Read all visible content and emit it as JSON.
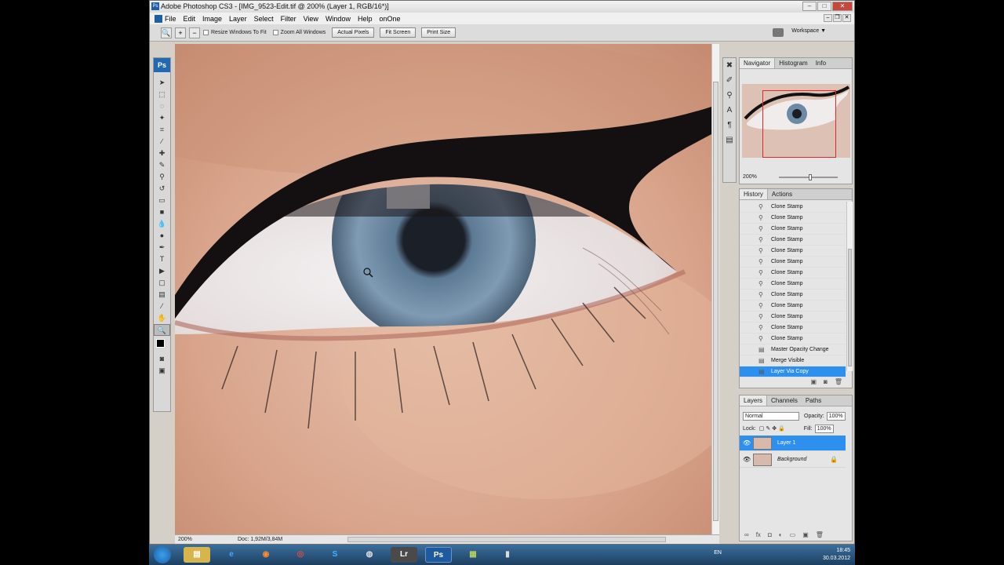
{
  "window": {
    "title": "Adobe Photoshop CS3 - [IMG_9523-Edit.tif @ 200% (Layer 1, RGB/16*)]",
    "app_badge": "Ps"
  },
  "menu": [
    "File",
    "Edit",
    "Image",
    "Layer",
    "Select",
    "Filter",
    "View",
    "Window",
    "Help",
    "onOne"
  ],
  "options_bar": {
    "resize_windows": "Resize Windows To Fit",
    "zoom_all": "Zoom All Windows",
    "actual_pixels": "Actual Pixels",
    "fit_screen": "Fit Screen",
    "print_size": "Print Size",
    "workspace": "Workspace ▼"
  },
  "status_bar": {
    "zoom": "200%",
    "doc": "Doc: 1,92M/3,84M"
  },
  "navigator": {
    "tabs": [
      "Navigator",
      "Histogram",
      "Info"
    ],
    "zoom": "200%"
  },
  "history": {
    "tabs": [
      "History",
      "Actions"
    ],
    "items": [
      "Clone Stamp",
      "Clone Stamp",
      "Clone Stamp",
      "Clone Stamp",
      "Clone Stamp",
      "Clone Stamp",
      "Clone Stamp",
      "Clone Stamp",
      "Clone Stamp",
      "Clone Stamp",
      "Clone Stamp",
      "Clone Stamp",
      "Clone Stamp",
      "Master Opacity Change",
      "Merge Visible",
      "Layer Via Copy"
    ]
  },
  "layers": {
    "tabs": [
      "Layers",
      "Channels",
      "Paths"
    ],
    "blend_mode": "Normal",
    "opacity_label": "Opacity:",
    "opacity": "100%",
    "lock_label": "Lock:",
    "fill_label": "Fill:",
    "fill": "100%",
    "items": [
      "Layer 1",
      "Background"
    ]
  },
  "taskbar": {
    "lang": "EN",
    "time": "18:45",
    "date": "30.03.2012"
  },
  "colors": {
    "selection": "#2d90ef",
    "ps_blue": "#2467b2"
  }
}
